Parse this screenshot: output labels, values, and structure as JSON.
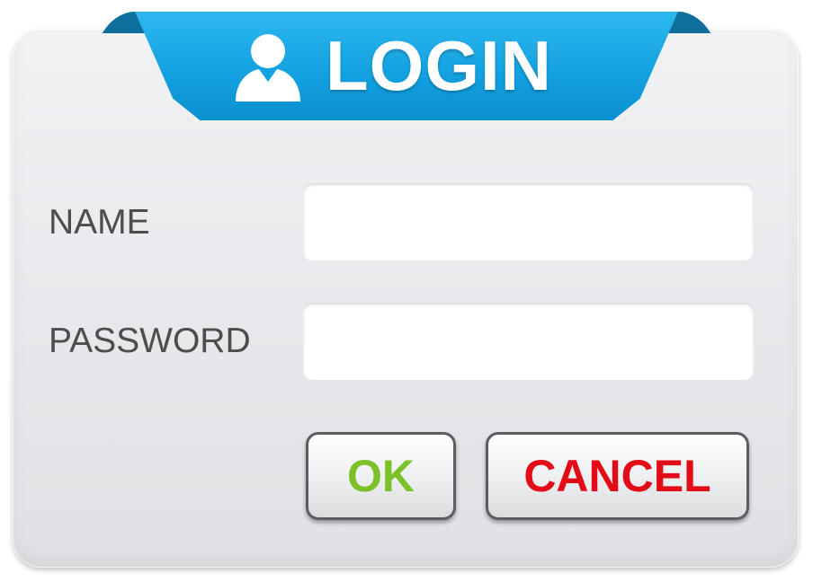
{
  "header": {
    "title": "LOGIN",
    "icon": "user-icon",
    "accent_color": "#12a0e0"
  },
  "form": {
    "name_label": "NAME",
    "name_value": "",
    "password_label": "PASSWORD",
    "password_value": ""
  },
  "buttons": {
    "ok_label": "OK",
    "ok_color": "#7cc12a",
    "cancel_label": "CANCEL",
    "cancel_color": "#e30b17"
  }
}
